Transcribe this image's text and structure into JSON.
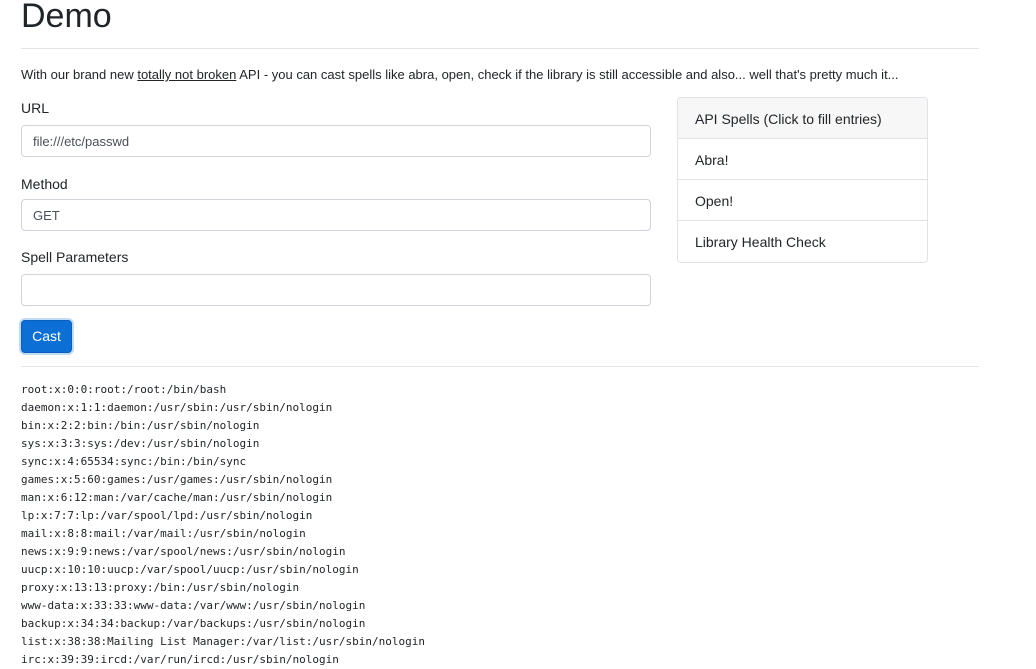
{
  "page": {
    "title": "Demo"
  },
  "intro": {
    "before": "With our brand new ",
    "link": "totally not broken",
    "after": " API - you can cast spells like abra, open, check if the library is still accessible and also... well that's pretty much it..."
  },
  "form": {
    "url_label": "URL",
    "url_value": "file:///etc/passwd",
    "method_label": "Method",
    "method_value": "GET",
    "params_label": "Spell Parameters",
    "params_value": "",
    "cast_label": "Cast"
  },
  "spells": {
    "header": "API Spells (Click to fill entries)",
    "items": [
      {
        "label": "Abra!"
      },
      {
        "label": "Open!"
      },
      {
        "label": "Library Health Check"
      }
    ]
  },
  "output": {
    "lines": [
      "root:x:0:0:root:/root:/bin/bash",
      "daemon:x:1:1:daemon:/usr/sbin:/usr/sbin/nologin",
      "bin:x:2:2:bin:/bin:/usr/sbin/nologin",
      "sys:x:3:3:sys:/dev:/usr/sbin/nologin",
      "sync:x:4:65534:sync:/bin:/bin/sync",
      "games:x:5:60:games:/usr/games:/usr/sbin/nologin",
      "man:x:6:12:man:/var/cache/man:/usr/sbin/nologin",
      "lp:x:7:7:lp:/var/spool/lpd:/usr/sbin/nologin",
      "mail:x:8:8:mail:/var/mail:/usr/sbin/nologin",
      "news:x:9:9:news:/var/spool/news:/usr/sbin/nologin",
      "uucp:x:10:10:uucp:/var/spool/uucp:/usr/sbin/nologin",
      "proxy:x:13:13:proxy:/bin:/usr/sbin/nologin",
      "www-data:x:33:33:www-data:/var/www:/usr/sbin/nologin",
      "backup:x:34:34:backup:/var/backups:/usr/sbin/nologin",
      "list:x:38:38:Mailing List Manager:/var/list:/usr/sbin/nologin",
      "irc:x:39:39:ircd:/var/run/ircd:/usr/sbin/nologin"
    ]
  }
}
